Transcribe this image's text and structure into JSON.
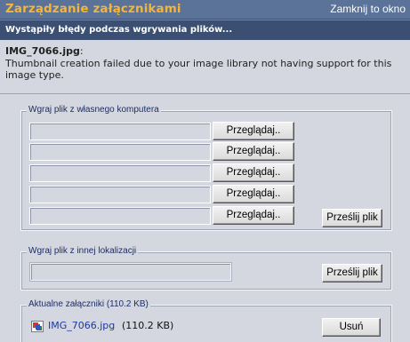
{
  "window": {
    "title": "Zarządzanie załącznikami",
    "close_label": "Zamknij to okno"
  },
  "error": {
    "heading": "Wystąpiły błędy podczas wgrywania plików...",
    "filename": "IMG_7066.jpg",
    "message": "Thumbnail creation failed due to your image library not having support for this image type."
  },
  "upload_local": {
    "legend": "Wgraj plik z własnego komputera",
    "browse_label": "Przeglądaj..",
    "send_label": "Prześlij plik"
  },
  "upload_remote": {
    "legend": "Wgraj plik z innej lokalizacji",
    "url_value": "",
    "send_label": "Prześlij plik"
  },
  "attachments": {
    "legend": "Aktualne załączniki (110.2 KB)",
    "items": [
      {
        "name": "IMG_7066.jpg",
        "size": "(110.2 KB)",
        "remove_label": "Usuń"
      }
    ]
  }
}
